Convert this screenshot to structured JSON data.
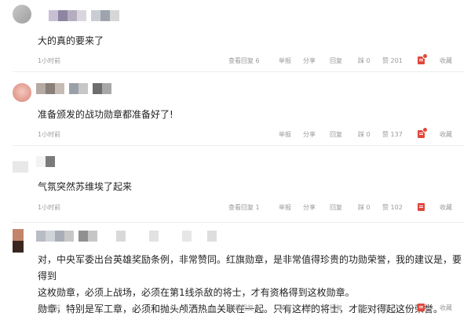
{
  "comments": [
    {
      "text": "大的真的要来了",
      "time": "1小时前",
      "view_replies": "查看回复 6",
      "report": "举报",
      "share": "分享",
      "reply": "回复",
      "dislike": "踩 0",
      "like": "赞 201",
      "collect": "收藏"
    },
    {
      "text": "准备颁发的战功勋章都准备好了!",
      "time": "1小时前",
      "report": "举报",
      "share": "分享",
      "reply": "回复",
      "dislike": "踩 0",
      "like": "赞 137",
      "collect": "收藏"
    },
    {
      "text": "气氛突然苏维埃了起来",
      "time": "1小时前",
      "view_replies": "查看回复 1",
      "report": "举报",
      "share": "分享",
      "reply": "回复",
      "dislike": "踩 0",
      "like": "赞 102",
      "collect": "收藏"
    },
    {
      "lines": [
        "对，中央军委出台英雄奖励条例，非常赞同。红旗勋章，是非常值得珍贵的功勋荣誉，我的建议是，要得到",
        "这枚勋章，必须上战场，必须在第1线杀敌的将士，才有资格得到这枚勋章。",
        "勋章，特别是军工章，必须和抛头颅洒热血关联在一起。只有这样的将士，才能对得起这份荣誉。"
      ],
      "time": "1小时前",
      "view_replies": "查看回复 8",
      "report": "举报",
      "share": "分享",
      "reply": "回复",
      "dislike": "踩 7",
      "like": "赞 77",
      "collect": "收藏"
    }
  ],
  "colors": {
    "badge_red": "#e0473b",
    "meta_gray": "#9a9a9a"
  }
}
